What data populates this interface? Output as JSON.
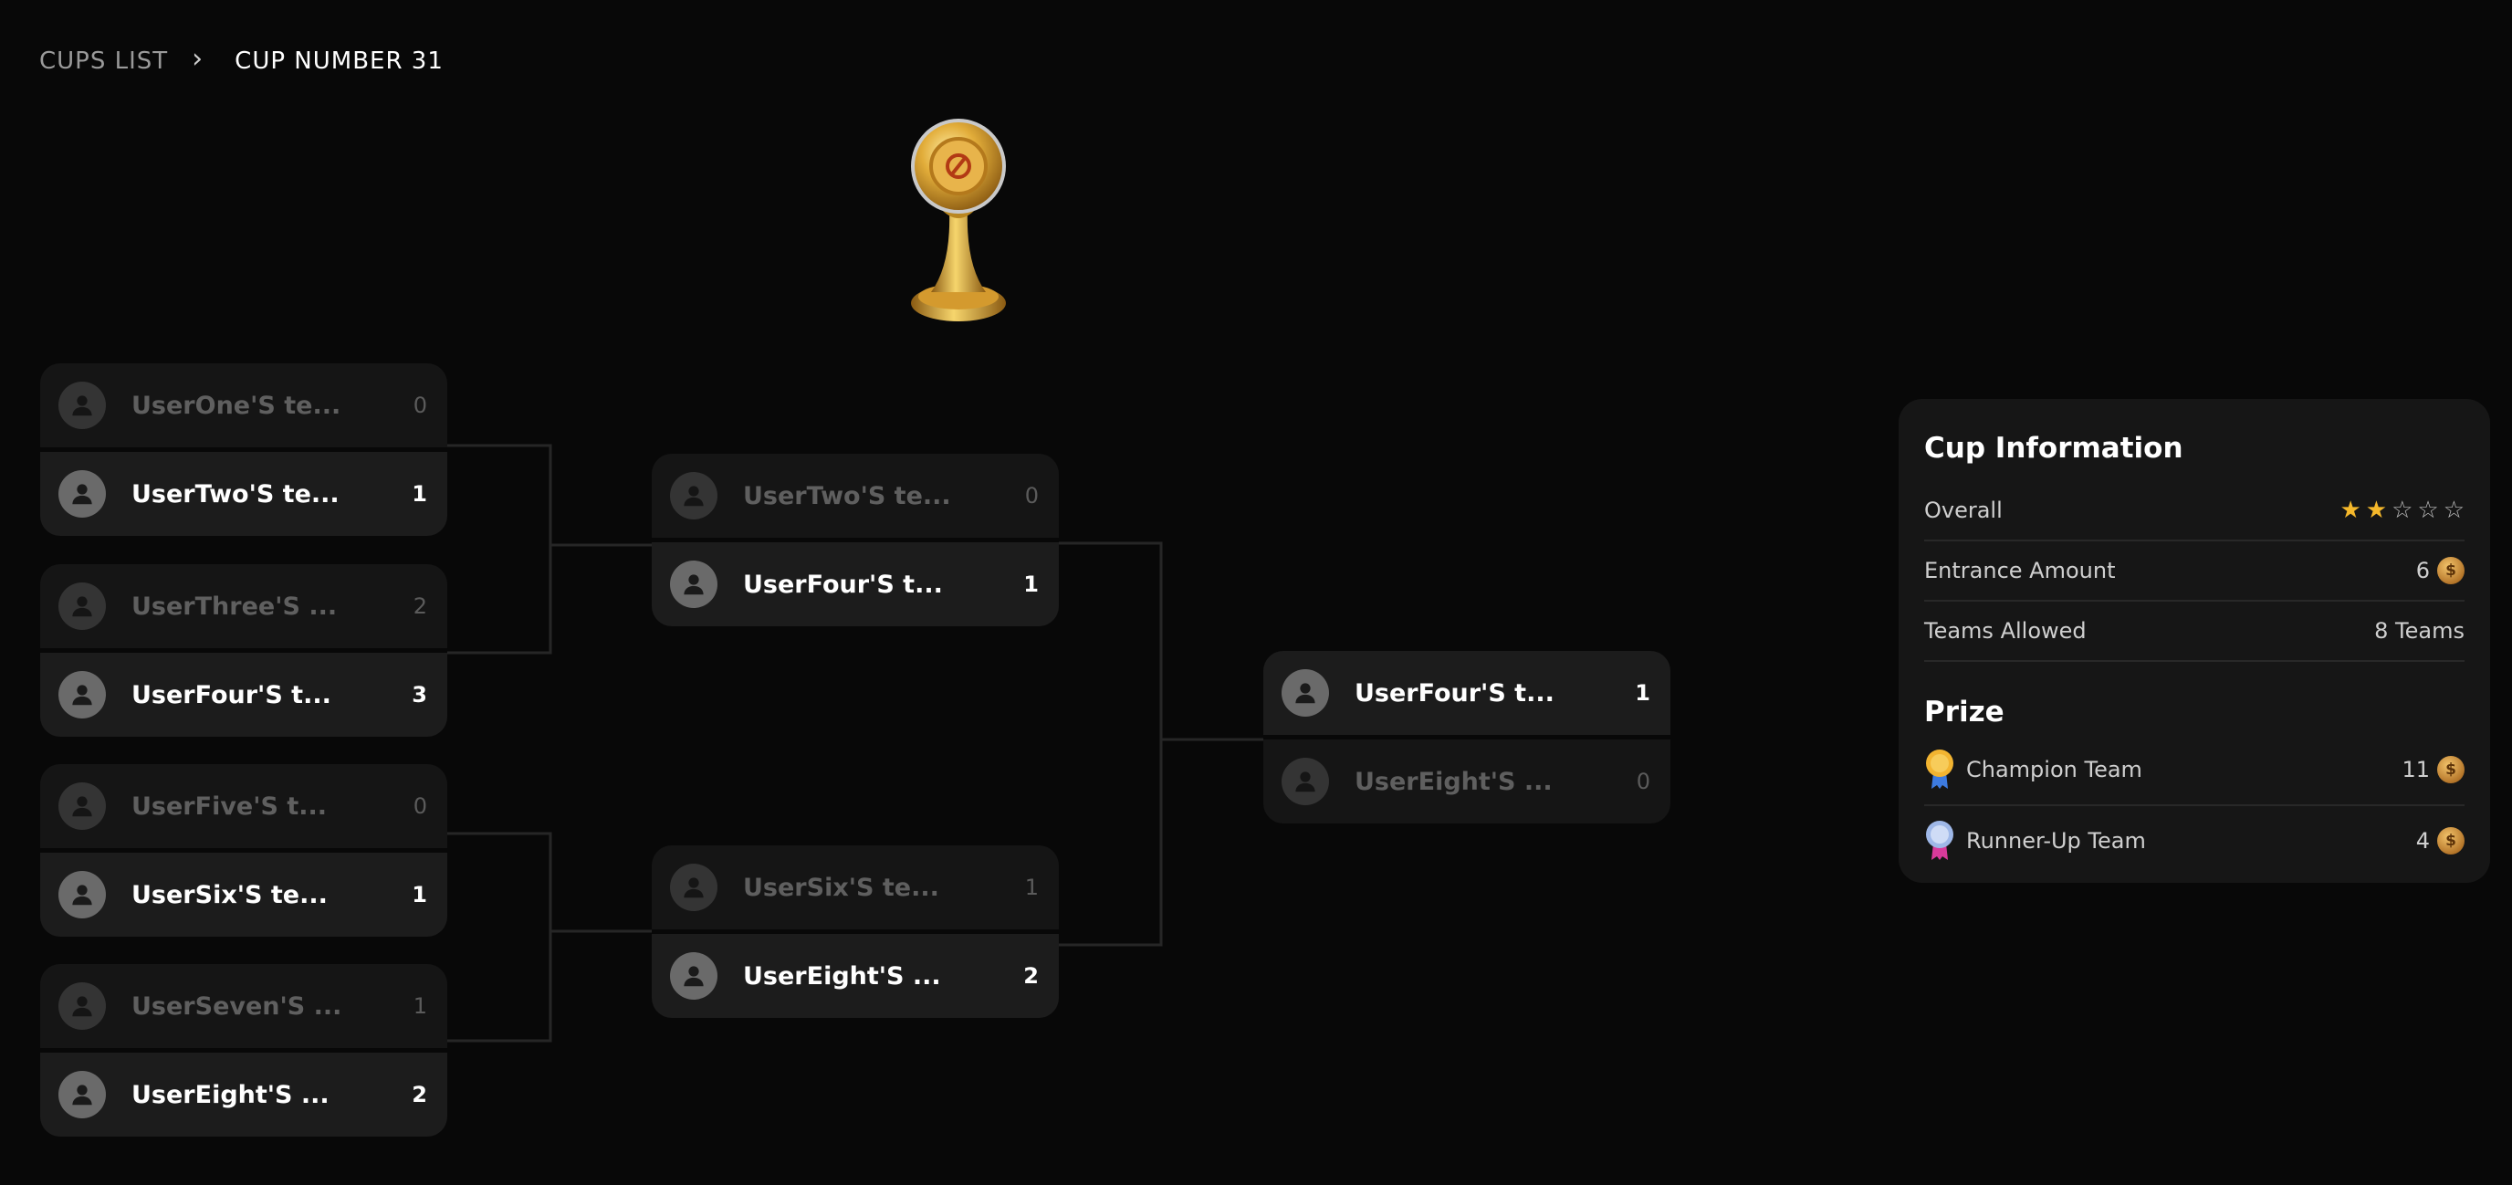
{
  "breadcrumb": {
    "root": "CUPS LIST",
    "separator": "›",
    "current": "CUP NUMBER 31"
  },
  "trophy_icon": "trophy-icon",
  "bracket": {
    "round1": [
      {
        "top": {
          "team": "UserOne'S te...",
          "score": "0",
          "winner": false
        },
        "bottom": {
          "team": "UserTwo'S te...",
          "score": "1",
          "winner": true
        }
      },
      {
        "top": {
          "team": "UserThree'S ...",
          "score": "2",
          "winner": false
        },
        "bottom": {
          "team": "UserFour'S t...",
          "score": "3",
          "winner": true
        }
      },
      {
        "top": {
          "team": "UserFive'S t...",
          "score": "0",
          "winner": false
        },
        "bottom": {
          "team": "UserSix'S te...",
          "score": "1",
          "winner": true
        }
      },
      {
        "top": {
          "team": "UserSeven'S ...",
          "score": "1",
          "winner": false
        },
        "bottom": {
          "team": "UserEight'S ...",
          "score": "2",
          "winner": true
        }
      }
    ],
    "round2": [
      {
        "top": {
          "team": "UserTwo'S te...",
          "score": "0",
          "winner": false
        },
        "bottom": {
          "team": "UserFour'S t...",
          "score": "1",
          "winner": true
        }
      },
      {
        "top": {
          "team": "UserSix'S te...",
          "score": "1",
          "winner": false
        },
        "bottom": {
          "team": "UserEight'S ...",
          "score": "2",
          "winner": true
        }
      }
    ],
    "final": [
      {
        "top": {
          "team": "UserFour'S t...",
          "score": "1",
          "winner": true
        },
        "bottom": {
          "team": "UserEight'S ...",
          "score": "0",
          "winner": false
        }
      }
    ]
  },
  "info": {
    "title": "Cup Information",
    "overall_label": "Overall",
    "overall_rating": 2,
    "overall_max": 5,
    "entrance_label": "Entrance Amount",
    "entrance_value": "6",
    "teams_label": "Teams Allowed",
    "teams_value": "8 Teams",
    "prize_title": "Prize",
    "champion_label": "Champion Team",
    "champion_value": "11",
    "runnerup_label": "Runner-Up Team",
    "runnerup_value": "4",
    "coin_symbol": "$"
  },
  "colors": {
    "background": "#080808",
    "card": "#1c1c1c",
    "card_loser": "#151515",
    "star": "#f5b82b",
    "coin": "#c98a36"
  }
}
